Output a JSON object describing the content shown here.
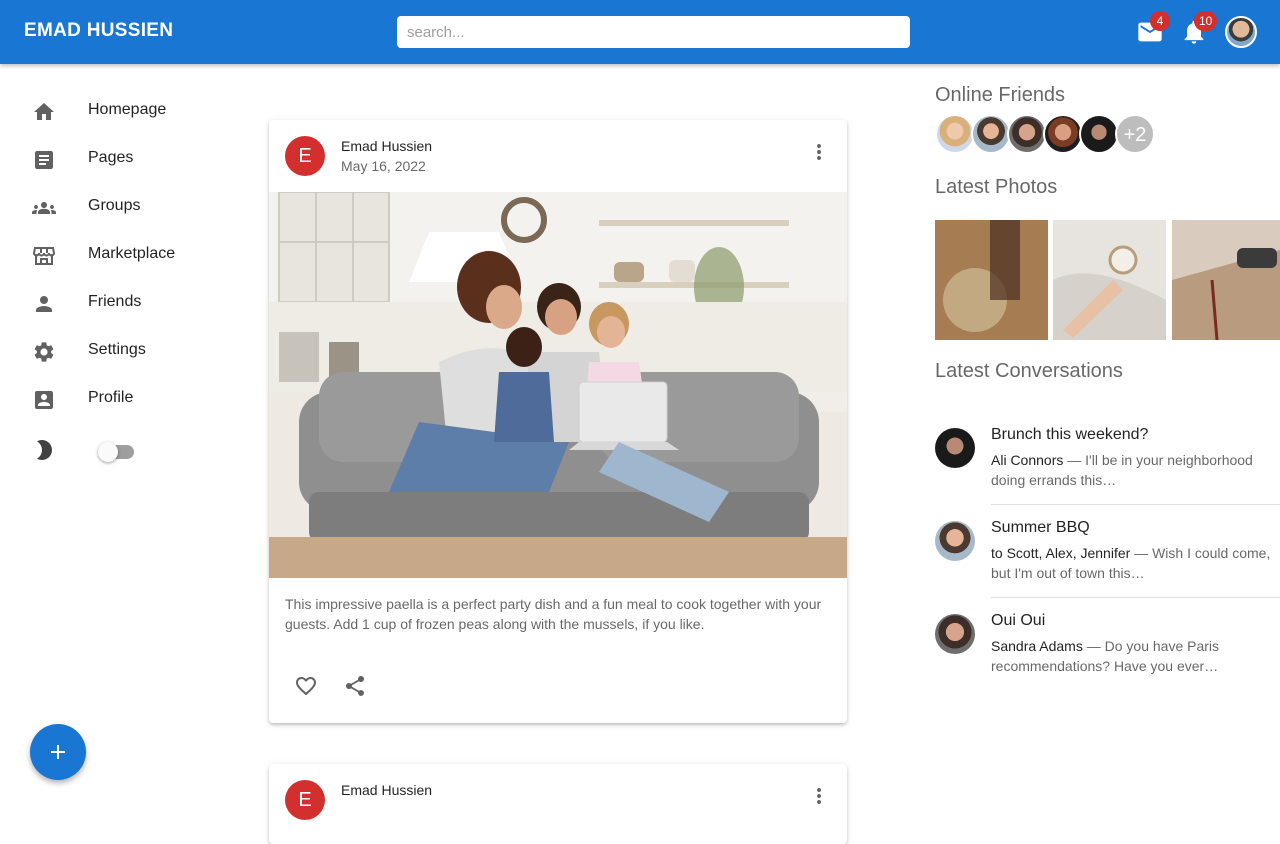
{
  "header": {
    "brand": "EMAD HUSSIEN",
    "search_placeholder": "search...",
    "mail_count": "4",
    "notif_count": "10",
    "color": "#1976d2"
  },
  "sidebar": {
    "items": [
      {
        "label": "Homepage",
        "icon": "home-icon"
      },
      {
        "label": "Pages",
        "icon": "article-icon"
      },
      {
        "label": "Groups",
        "icon": "groups-icon"
      },
      {
        "label": "Marketplace",
        "icon": "storefront-icon"
      },
      {
        "label": "Friends",
        "icon": "person-icon"
      },
      {
        "label": "Settings",
        "icon": "gear-icon"
      },
      {
        "label": "Profile",
        "icon": "account-box-icon"
      }
    ],
    "theme_icon": "moon-icon"
  },
  "feed": {
    "posts": [
      {
        "avatar_letter": "E",
        "author": "Emad Hussien",
        "date": "May 16, 2022",
        "caption": "This impressive paella is a perfect party dish and a fun meal to cook together with your guests. Add 1 cup of frozen peas along with the mussels, if you like."
      },
      {
        "avatar_letter": "E",
        "author": "Emad Hussien"
      }
    ]
  },
  "rightbar": {
    "online_title": "Online Friends",
    "more_friends": "+2",
    "photos_title": "Latest Photos",
    "conversations_title": "Latest Conversations",
    "conversations": [
      {
        "title": "Brunch this weekend?",
        "sender": "Ali Connors",
        "snippet": " — I'll be in your neighborhood doing errands this…"
      },
      {
        "title": "Summer BBQ",
        "sender": "to Scott, Alex, Jennifer",
        "snippet": " — Wish I could come, but I'm out of town this…"
      },
      {
        "title": "Oui Oui",
        "sender": "Sandra Adams",
        "snippet": " — Do you have Paris recommendations? Have you ever…"
      }
    ]
  }
}
